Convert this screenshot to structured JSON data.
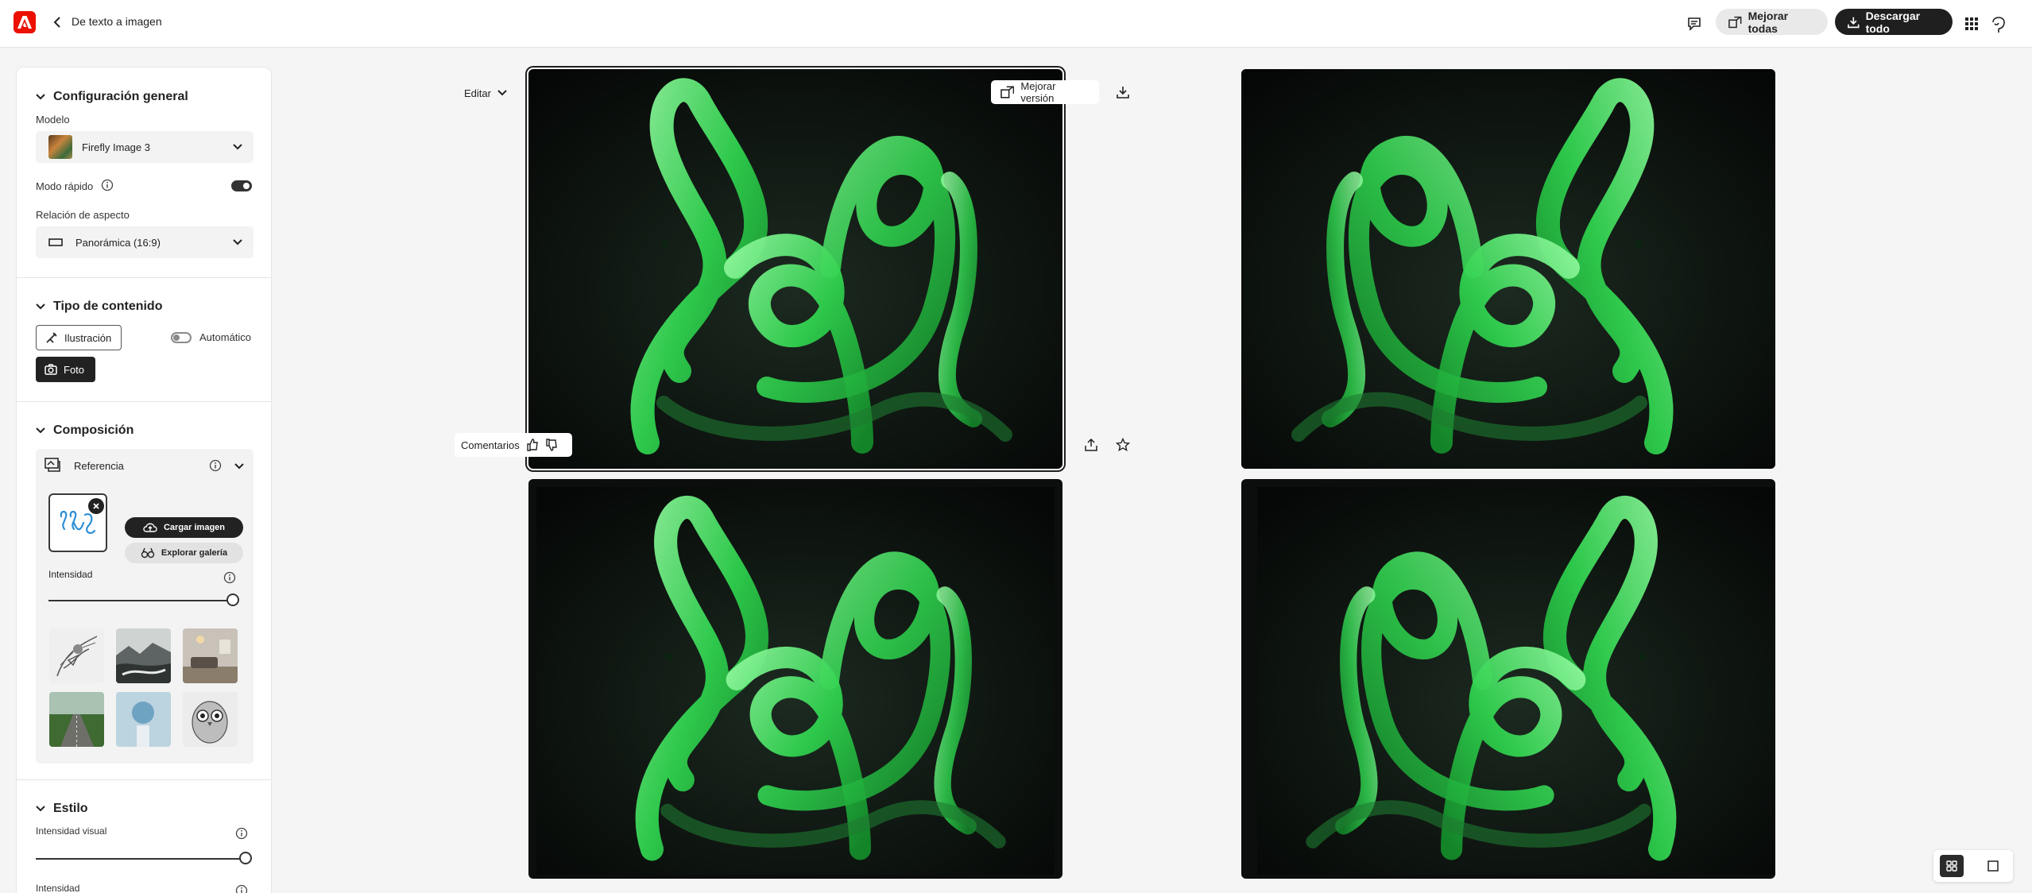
{
  "app": {
    "page_title": "De texto a imagen",
    "actions": {
      "comment_icon": "comment-icon",
      "upscale_all_label": "Mejorar todas",
      "download_all_label": "Descargar todo"
    }
  },
  "sidebar": {
    "general": {
      "title": "Configuración general",
      "model_label": "Modelo",
      "model_value": "Firefly Image 3",
      "fast_mode_label": "Modo rápido",
      "fast_mode_on": true,
      "aspect_label": "Relación de aspecto",
      "aspect_value": "Panorámica (16:9)"
    },
    "content_type": {
      "title": "Tipo de contenido",
      "illustration_label": "Ilustración",
      "auto_label": "Automático",
      "auto_on": false,
      "photo_label": "Foto",
      "selected": "Foto"
    },
    "composition": {
      "title": "Composición",
      "reference_label": "Referencia",
      "upload_label": "Cargar imagen",
      "browse_label": "Explorar galería",
      "intensity_label": "Intensidad",
      "intensity_value": 1.0,
      "presets": [
        "sketch-bird",
        "mountains",
        "living-room",
        "road-field",
        "sphere-pedestal",
        "owl-drawing"
      ]
    },
    "style": {
      "title": "Estilo",
      "visual_intensity_label": "Intensidad visual",
      "visual_intensity_value": 1.0,
      "intensity_label": "Intensidad"
    }
  },
  "canvas": {
    "edit_label": "Editar",
    "upscale_version_label": "Mejorar versión",
    "feedback_label": "Comentarios",
    "selected_index": 0,
    "images_count": 4
  },
  "colors": {
    "brand": "#eb1000",
    "dark": "#1f1f1f",
    "snake_green": "#3ddc5a"
  }
}
